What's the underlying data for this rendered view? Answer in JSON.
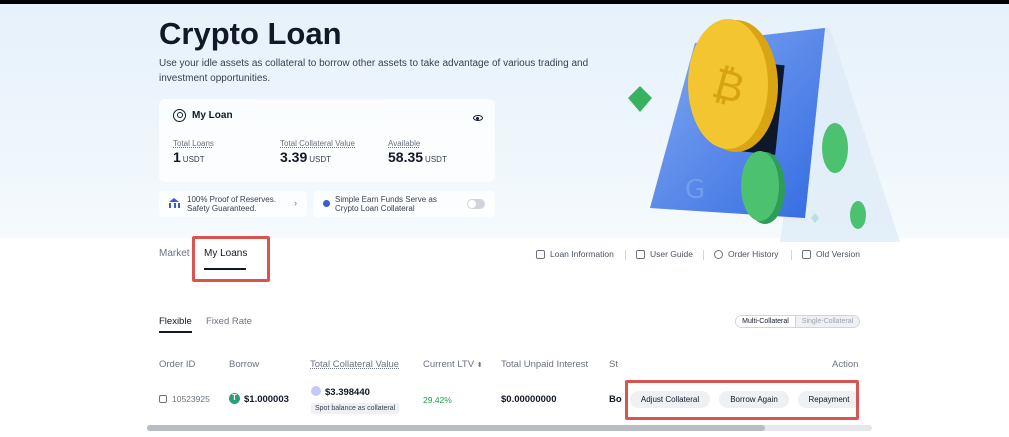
{
  "hero": {
    "title": "Crypto Loan",
    "subtitle": "Use your idle assets as collateral to borrow other assets to take advantage of various trading and investment opportunities."
  },
  "my_loan": {
    "title": "My Loan",
    "stats": [
      {
        "label": "Total Loans",
        "value": "1",
        "unit": "USDT"
      },
      {
        "label": "Total Collateral Value",
        "value": "3.39",
        "unit": "USDT"
      },
      {
        "label": "Available",
        "value": "58.35",
        "unit": "USDT"
      }
    ]
  },
  "info": {
    "reserves_line1": "100% Proof of Reserves.",
    "reserves_line2": "Safety Guaranteed.",
    "earn_line1": "Simple Earn Funds Serve as",
    "earn_line2": "Crypto Loan Collateral"
  },
  "tabs": {
    "market": "Market",
    "my_loans": "My Loans"
  },
  "links": {
    "loan_information": "Loan Information",
    "user_guide": "User Guide",
    "order_history": "Order History",
    "old_version": "Old Version"
  },
  "sub_tabs": {
    "flexible": "Flexible",
    "fixed_rate": "Fixed Rate"
  },
  "segment": {
    "multi": "Multi-Collateral",
    "single": "Single-Collateral"
  },
  "table": {
    "headers": {
      "order_id": "Order ID",
      "borrow": "Borrow",
      "total_collateral": "Total Collateral Value",
      "current_ltv": "Current LTV",
      "unpaid": "Total Unpaid Interest",
      "status": "St",
      "action": "Action"
    },
    "row": {
      "order_id": "10523925",
      "borrow": "$1.000003",
      "collateral": "$3.398440",
      "collateral_note": "Spot balance as collateral",
      "ltv": "29.42%",
      "unpaid": "$0.00000000",
      "status": "Bo"
    },
    "actions": {
      "adjust": "Adjust Collateral",
      "borrow_again": "Borrow Again",
      "repayment": "Repayment"
    }
  },
  "colors": {
    "accent_red": "#d9534f",
    "ltv_green": "#16a34a",
    "usdt_green": "#26a17b"
  }
}
